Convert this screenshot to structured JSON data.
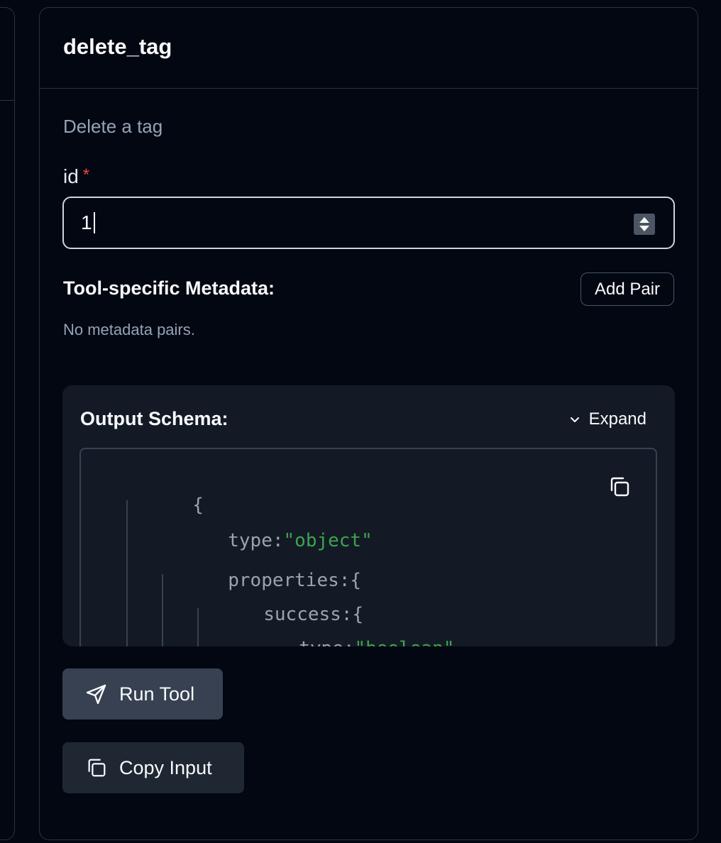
{
  "tool": {
    "name": "delete_tag",
    "description": "Delete a tag"
  },
  "field": {
    "label": "id",
    "required_mark": "*",
    "value": "1"
  },
  "metadata": {
    "label": "Tool-specific Metadata:",
    "add_button": "Add Pair",
    "empty_text": "No metadata pairs."
  },
  "schema": {
    "title": "Output Schema:",
    "expand_label": "Expand",
    "lines": {
      "open": "{",
      "type_key": "type:",
      "type_val": "\"object\"",
      "props_key": "properties:",
      "props_open": "{",
      "success_key": "success:",
      "success_open": "{",
      "inner_type_key": "type:",
      "inner_type_val": "\"boolean\""
    }
  },
  "actions": {
    "run_label": "Run Tool",
    "copy_label": "Copy Input"
  },
  "colors": {
    "background": "#030711",
    "string": "#3fa34d",
    "required": "#ef4444"
  },
  "icons": [
    "chevron-down-icon",
    "copy-icon",
    "send-icon"
  ]
}
